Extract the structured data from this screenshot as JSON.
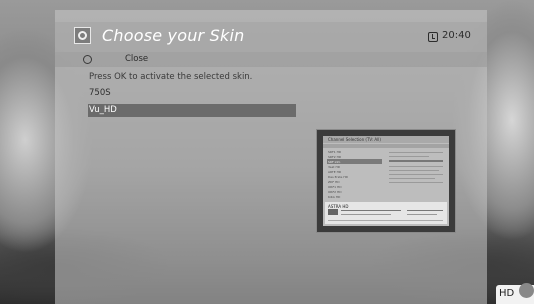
{
  "header": {
    "title": "Choose your Skin",
    "time": "20:40"
  },
  "keys": {
    "close_label": "Close"
  },
  "hint": "Press OK to activate the selected skin.",
  "skins": [
    {
      "label": "750S",
      "selected": false
    },
    {
      "label": "Vu_HD",
      "selected": true
    }
  ],
  "preview": {
    "title": "Channel Selection (TV: All)",
    "channels": [
      "SRF1 HD",
      "SRF2 HD",
      "SRF info",
      "3sat HD",
      "ARTE HD",
      "Das Erste HD",
      "ZDF HD",
      "ORF1 HD",
      "ORF2 HD",
      "KiKA HD"
    ],
    "selected_channel_index": 2,
    "info_box_title": "ASTRA HD"
  },
  "badge": "HD"
}
